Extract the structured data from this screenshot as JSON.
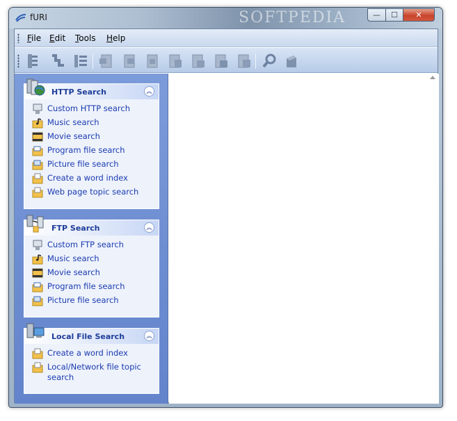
{
  "window": {
    "title": "fURI",
    "watermark": "SOFTPEDIA",
    "controls": {
      "minimize": "—",
      "maximize": "☐",
      "close": "✕"
    }
  },
  "menu": [
    {
      "accel": "F",
      "rest": "ile"
    },
    {
      "accel": "E",
      "rest": "dit"
    },
    {
      "accel": "T",
      "rest": "ools"
    },
    {
      "accel": "H",
      "rest": "elp"
    }
  ],
  "toolbar": {
    "buttons": [
      "list-view-icon",
      "tree-view-icon",
      "details-view-icon",
      "page-back-icon",
      "page-forward-icon",
      "page-copy-icon",
      "page-cut-icon",
      "page-paste-icon",
      "page-delete-icon",
      "page-properties-icon",
      "search-icon",
      "database-icon"
    ]
  },
  "panels": {
    "http": {
      "title": "HTTP Search",
      "items": [
        "Custom HTTP search",
        "Music search",
        "Movie search",
        "Program file search",
        "Picture file search",
        "Create a word index",
        "Web page topic search"
      ]
    },
    "ftp": {
      "title": "FTP Search",
      "items": [
        "Custom FTP search",
        "Music search",
        "Movie search",
        "Program file search",
        "Picture file search"
      ]
    },
    "local": {
      "title": "Local File Search",
      "items": [
        "Create a word index",
        "Local/Network file topic search"
      ]
    }
  },
  "colors": {
    "pane_blue": "#6f8fd3",
    "link_blue": "#1a3bb0",
    "header_blue": "#1f3d9a"
  }
}
